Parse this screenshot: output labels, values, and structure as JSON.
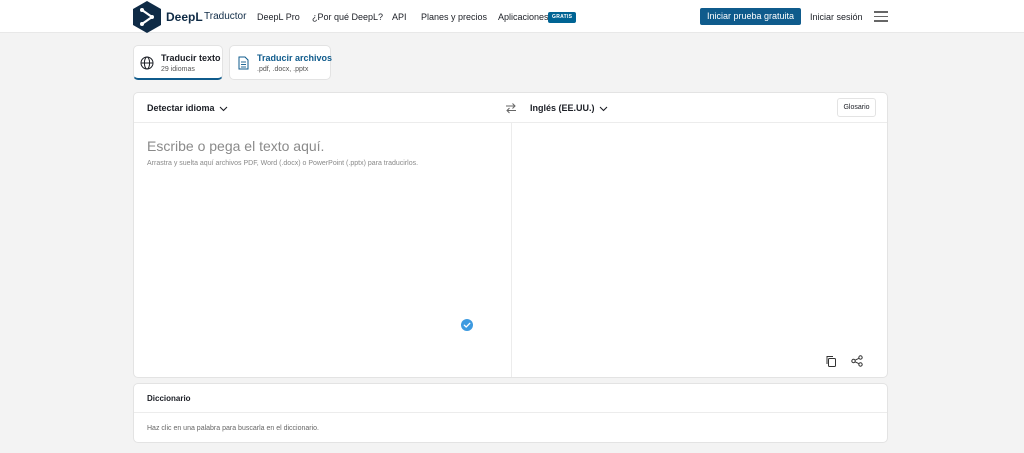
{
  "header": {
    "brand": "DeepL",
    "brand_sub": "Traductor",
    "nav": [
      "DeepL Pro",
      "¿Por qué DeepL?",
      "API",
      "Planes y precios",
      "Aplicaciones"
    ],
    "badge": "GRATIS",
    "cta": "Iniciar prueba gratuita",
    "login": "Iniciar sesión"
  },
  "tabs": [
    {
      "title": "Traducir texto",
      "sub": "29 idiomas"
    },
    {
      "title": "Traducir archivos",
      "sub": ".pdf, .docx, .pptx"
    }
  ],
  "translator": {
    "source_lang": "Detectar idioma",
    "target_lang": "Inglés (EE.UU.)",
    "glossary": "Glosario",
    "placeholder": "Escribe o pega el texto aquí.",
    "hint": "Arrastra y suelta aquí archivos PDF, Word (.docx) o PowerPoint (.pptx) para traducirlos."
  },
  "dictionary": {
    "title": "Diccionario",
    "text": "Haz clic en una palabra para buscarla en el diccionario."
  },
  "colors": {
    "brand_navy": "#0f2b46",
    "accent_blue": "#0f5b8c",
    "check_blue": "#3d9ae0"
  }
}
